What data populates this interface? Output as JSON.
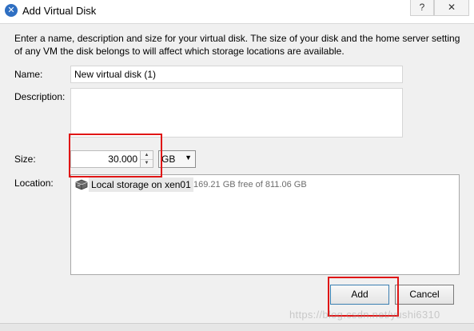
{
  "window": {
    "title": "Add Virtual Disk",
    "help_label": "?",
    "close_label": "✕",
    "app_icon": "xencenter-x-icon"
  },
  "intro": {
    "text": "Enter a name, description and size for your virtual disk. The size of your disk and the home server setting of any VM the disk belongs to will affect which storage locations are available."
  },
  "form": {
    "name_label": "Name:",
    "name_value": "New virtual disk (1)",
    "description_label": "Description:",
    "description_value": "",
    "size_label": "Size:",
    "size_value": "30.000",
    "size_unit": "GB",
    "location_label": "Location:"
  },
  "locations": [
    {
      "name": "Local storage on xen01",
      "free": "169.21 GB free of 811.06 GB",
      "icon": "storage-disk-icon",
      "selected": true
    }
  ],
  "buttons": {
    "add_label": "Add",
    "cancel_label": "Cancel"
  },
  "watermark": "https://blog.csdn.net/yushi6310",
  "colors": {
    "highlight": "#e01616",
    "selection_bg": "#e8e8e8"
  }
}
